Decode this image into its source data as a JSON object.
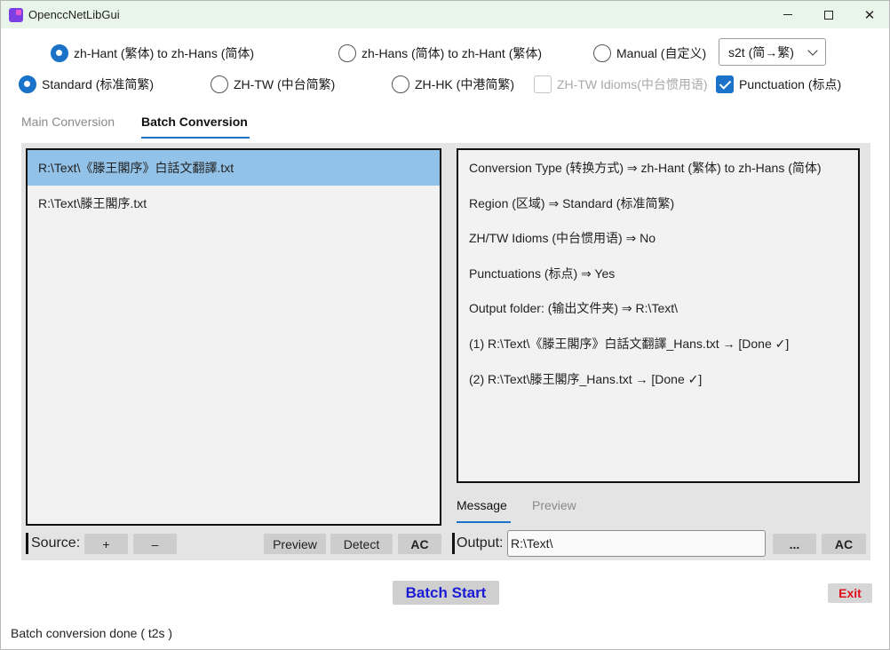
{
  "window": {
    "title": "OpenccNetLibGui"
  },
  "conversion": {
    "options": [
      {
        "label": "zh-Hant (繁体) to zh-Hans (简体)",
        "selected": true
      },
      {
        "label": "zh-Hans (简体) to zh-Hant (繁体)",
        "selected": false
      },
      {
        "label": "Manual (自定义)",
        "selected": false
      }
    ],
    "manual_select": "s2t (简→繁)"
  },
  "region": {
    "options": [
      {
        "label": "Standard (标准简繁)",
        "selected": true
      },
      {
        "label": "ZH-TW (中台简繁)",
        "selected": false
      },
      {
        "label": "ZH-HK (中港简繁)",
        "selected": false
      }
    ],
    "idioms": {
      "label": "ZH-TW Idioms(中台惯用语)",
      "checked": false,
      "enabled": false
    },
    "punctuation": {
      "label": "Punctuation (标点)",
      "checked": true
    }
  },
  "tabs": {
    "main": "Main Conversion",
    "batch": "Batch Conversion"
  },
  "files": [
    "R:\\Text\\《滕王閣序》白話文翻譯.txt",
    "R:\\Text\\滕王閣序.txt"
  ],
  "info": {
    "lines": [
      "Conversion Type (转换方式) ⇒ zh-Hant (繁体) to zh-Hans (简体)",
      "Region (区域) ⇒ Standard (标准简繁)",
      "ZH/TW Idioms (中台惯用语) ⇒ No",
      "Punctuations (标点) ⇒ Yes",
      "Output folder: (输出文件夹) ⇒ R:\\Text\\",
      "(1) R:\\Text\\《滕王閣序》白話文翻譯_Hans.txt → [Done ✓]",
      "(2) R:\\Text\\滕王閣序_Hans.txt → [Done ✓]"
    ]
  },
  "source": {
    "label": "Source:",
    "add": "+",
    "remove": "–",
    "preview": "Preview",
    "detect": "Detect",
    "clear": "AC"
  },
  "output_tabs": {
    "message": "Message",
    "preview": "Preview"
  },
  "output": {
    "label": "Output:",
    "path": "R:\\Text\\",
    "browse": "...",
    "clear": "AC"
  },
  "actions": {
    "start": "Batch Start",
    "exit": "Exit"
  },
  "status": "Batch conversion done ( t2s )",
  "colors": {
    "accent": "#1a73c8",
    "selection": "#93c2e8",
    "start_text": "#1b1bd6",
    "exit_text": "#e0101a"
  }
}
